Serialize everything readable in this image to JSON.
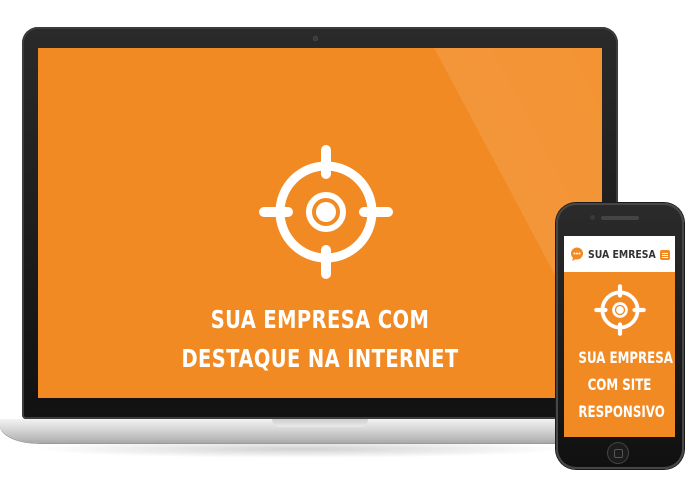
{
  "laptop": {
    "headline_line1": "SUA EMPRESA COM",
    "headline_line2": "DESTAQUE NA INTERNET",
    "icon": "target-crosshair-icon"
  },
  "phone": {
    "brand": "SUA EMRESA",
    "logo_icon": "chat-bubble-logo-icon",
    "menu_icon": "hamburger-menu-icon",
    "icon": "target-crosshair-icon",
    "headline_line1": "SUA EMPRESA",
    "headline_line2": "COM SITE",
    "headline_line3": "RESPONSIVO"
  },
  "colors": {
    "accent": "#f28a23",
    "text_on_accent": "#ffffff",
    "device_frame": "#1a1a1a"
  }
}
